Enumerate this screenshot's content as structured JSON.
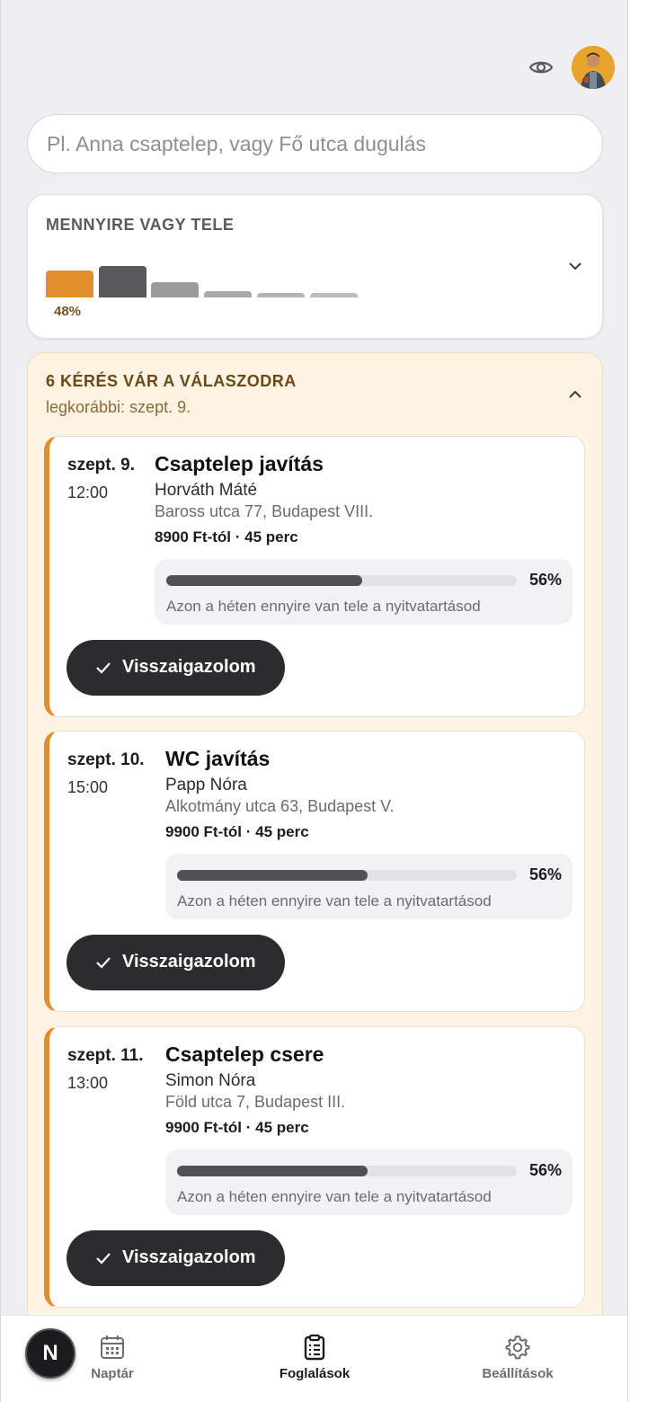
{
  "header": {
    "visibility_icon": "eye-icon",
    "avatar_icon": "user-avatar"
  },
  "search": {
    "placeholder": "Pl. Anna csaptelep, vagy Fő utca dugulás",
    "value": ""
  },
  "fill_widget": {
    "title": "MENNYIRE VAGY TELE",
    "percent_label": "48%",
    "bar_levels": [
      0.48,
      0.56,
      0.28,
      0.12,
      0.08,
      0.08
    ],
    "bar_colors": [
      "#e08f2c",
      "#58585d",
      "#9b9b9f",
      "#a9a9ad",
      "#b4b4b8",
      "#bcbcc0"
    ],
    "toggle_icon": "chevron-down-icon"
  },
  "requests": {
    "title": "6 KÉRÉS VÁR A VÁLASZODRA",
    "subtitle": "legkorábbi: szept. 9.",
    "toggle_icon": "chevron-up-icon",
    "items": [
      {
        "date": "szept. 9.",
        "time": "12:00",
        "service": "Csaptelep javítás",
        "customer": "Horváth Máté",
        "address": "Baross utca 77, Budapest VIII.",
        "price": "8900 Ft-tól · 45 perc",
        "week_fill": 0.56,
        "week_fill_label": "56%",
        "week_fill_caption": "Azon a héten ennyire van tele a nyitvatartásod",
        "confirm_label": "Visszaigazolom"
      },
      {
        "date": "szept. 10.",
        "time": "15:00",
        "service": "WC javítás",
        "customer": "Papp Nóra",
        "address": "Alkotmány utca 63, Budapest V.",
        "price": "9900 Ft-tól · 45 perc",
        "week_fill": 0.56,
        "week_fill_label": "56%",
        "week_fill_caption": "Azon a héten ennyire van tele a nyitvatartásod",
        "confirm_label": "Visszaigazolom"
      },
      {
        "date": "szept. 11.",
        "time": "13:00",
        "service": "Csaptelep csere",
        "customer": "Simon Nóra",
        "address": "Föld utca 7, Budapest III.",
        "price": "9900 Ft-tól · 45 perc",
        "week_fill": 0.56,
        "week_fill_label": "56%",
        "week_fill_caption": "Azon a héten ennyire van tele a nyitvatartásod",
        "confirm_label": "Visszaigazolom"
      }
    ]
  },
  "nav": {
    "logo": "N",
    "items": [
      {
        "label": "Naptár",
        "icon": "calendar-icon",
        "active": false
      },
      {
        "label": "Foglalások",
        "icon": "clipboard-list-icon",
        "active": true
      },
      {
        "label": "Beállítások",
        "icon": "gear-icon",
        "active": false
      }
    ]
  },
  "colors": {
    "accent": "#e08f2c",
    "panel_bg": "#fdf3e3",
    "dark_button": "#2c2c2e"
  }
}
